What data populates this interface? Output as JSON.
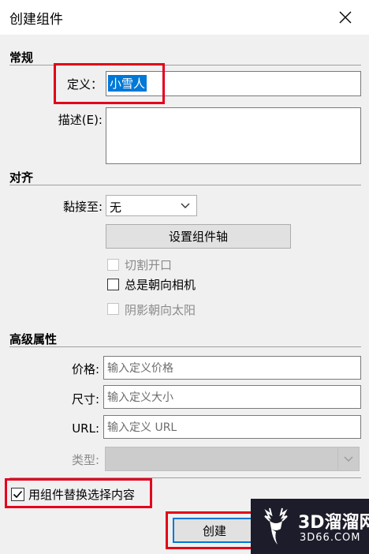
{
  "window": {
    "title": "创建组件"
  },
  "general": {
    "section_label": "常规",
    "definition_label": "定义：",
    "definition_value": "小雪人",
    "description_label": "描述(E):",
    "description_value": ""
  },
  "alignment": {
    "section_label": "对齐",
    "glue_label": "黏接至:",
    "glue_value": "无",
    "set_axes_button": "设置组件轴",
    "cut_opening": "切割开口",
    "always_face_camera": "总是朝向相机",
    "shadows_face_sun": "阴影朝向太阳"
  },
  "advanced": {
    "section_label": "高级属性",
    "price_label": "价格:",
    "price_placeholder": "输入定义价格",
    "size_label": "尺寸:",
    "size_placeholder": "输入定义大小",
    "url_label": "URL:",
    "url_placeholder": "输入定义 URL",
    "type_label": "类型:",
    "type_value": ""
  },
  "replace_selection": {
    "label": "用组件替换选择内容",
    "checked": true
  },
  "create_button": "创建",
  "watermark": {
    "brand": "3D溜溜网",
    "url": "3D66.COM"
  }
}
